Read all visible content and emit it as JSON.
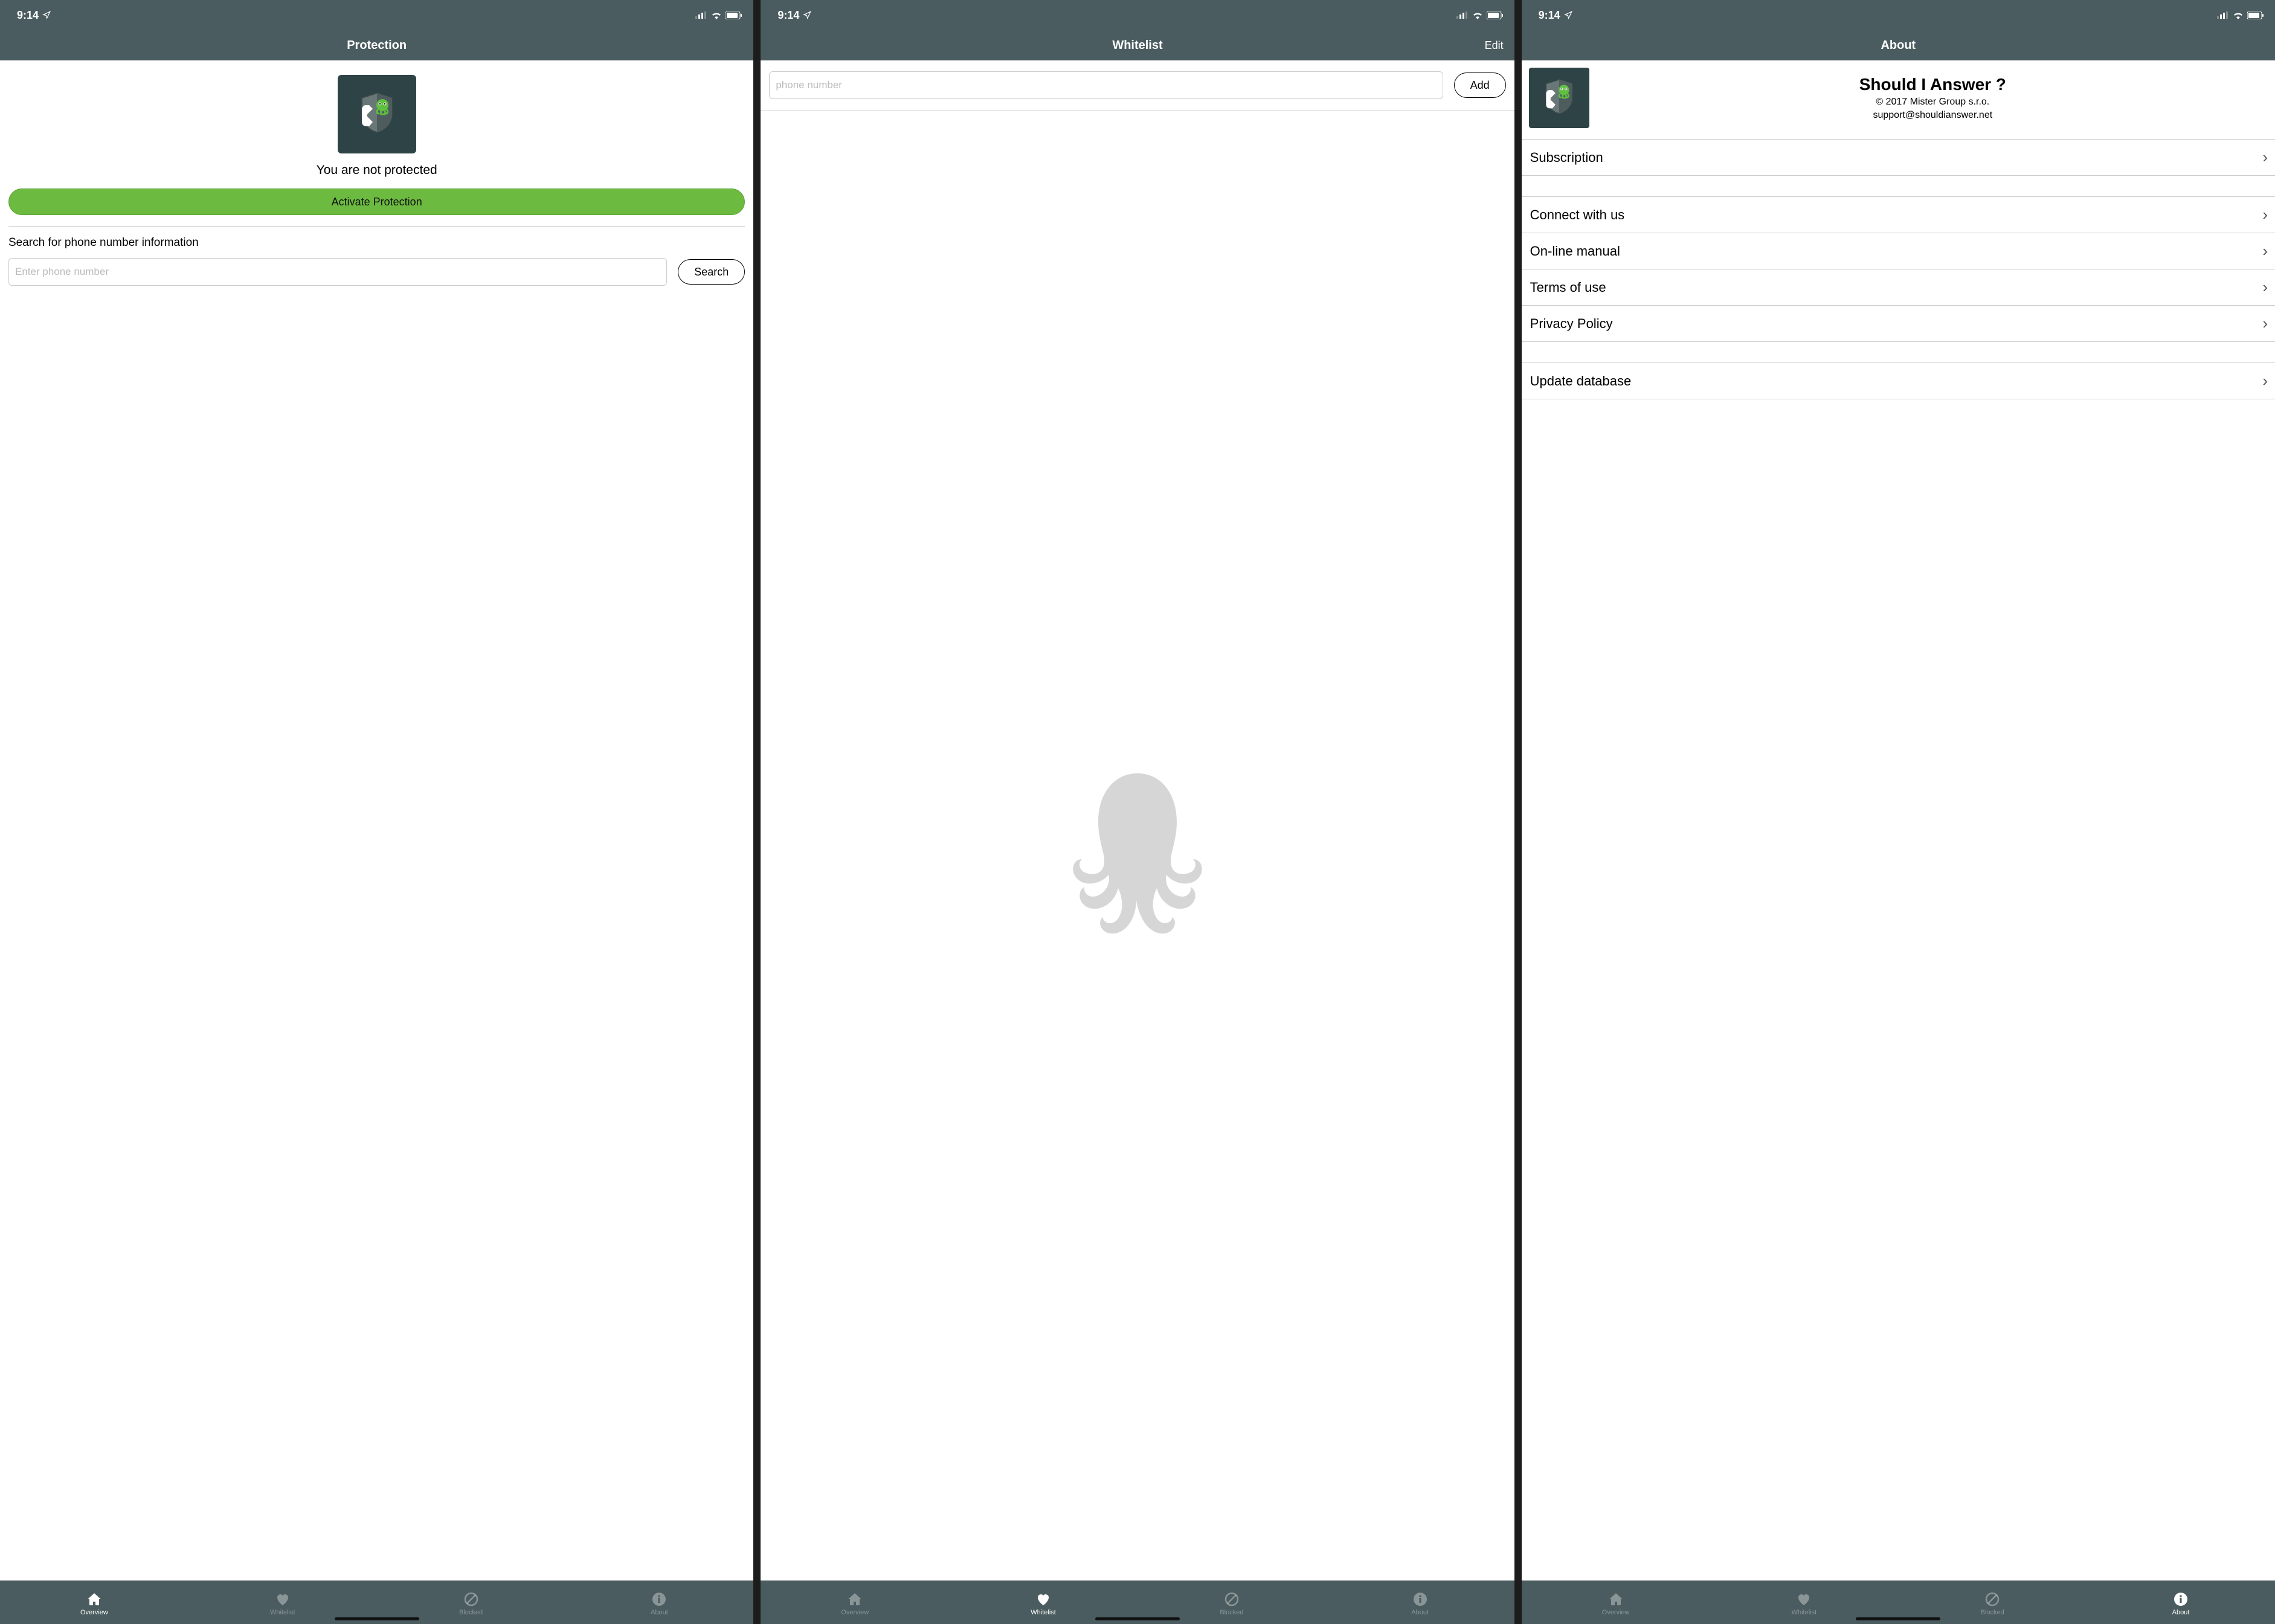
{
  "status": {
    "time": "9:14"
  },
  "tabs": {
    "overview": "Overview",
    "whitelist": "Whitelist",
    "blocked": "Blocked",
    "about": "About"
  },
  "screen1": {
    "title": "Protection",
    "status_text": "You are not protected",
    "activate_label": "Activate Protection",
    "search_heading": "Search for phone number information",
    "search_placeholder": "Enter phone number",
    "search_button": "Search"
  },
  "screen2": {
    "title": "Whitelist",
    "edit": "Edit",
    "input_placeholder": "phone number",
    "add_button": "Add"
  },
  "screen3": {
    "title": "About",
    "app_name": "Should I Answer ?",
    "copyright": "© 2017 Mister Group s.r.o.",
    "support_email": "support@shouldianswer.net",
    "rows_group1": [
      "Subscription"
    ],
    "rows_group2": [
      "Connect with us",
      "On-line manual",
      "Terms of use",
      "Privacy Policy"
    ],
    "rows_group3": [
      "Update database"
    ]
  }
}
